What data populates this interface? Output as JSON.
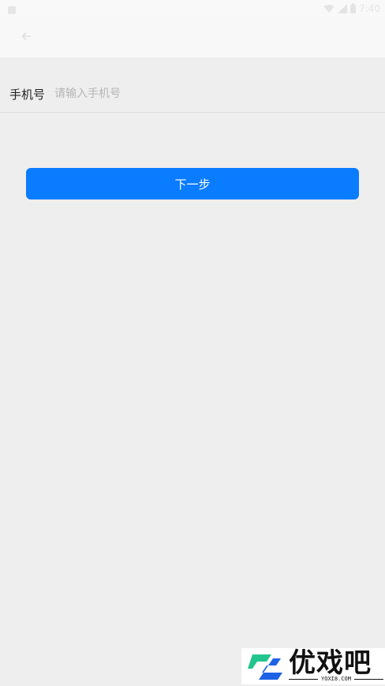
{
  "status_bar": {
    "time": "7:40"
  },
  "form": {
    "phone_label": "手机号",
    "phone_placeholder": "请输入手机号",
    "phone_value": ""
  },
  "actions": {
    "next_label": "下一步"
  },
  "watermark": {
    "brand": "优戏吧",
    "url": "YOXI8.COM"
  },
  "colors": {
    "accent": "#0a7cff",
    "background": "#eeeeee",
    "app_bar": "#f8f8f8"
  },
  "icons": {
    "back": "arrow-left-icon",
    "status_left": "notification-icon",
    "wifi": "wifi-icon",
    "signal": "signal-icon",
    "battery": "battery-icon"
  }
}
